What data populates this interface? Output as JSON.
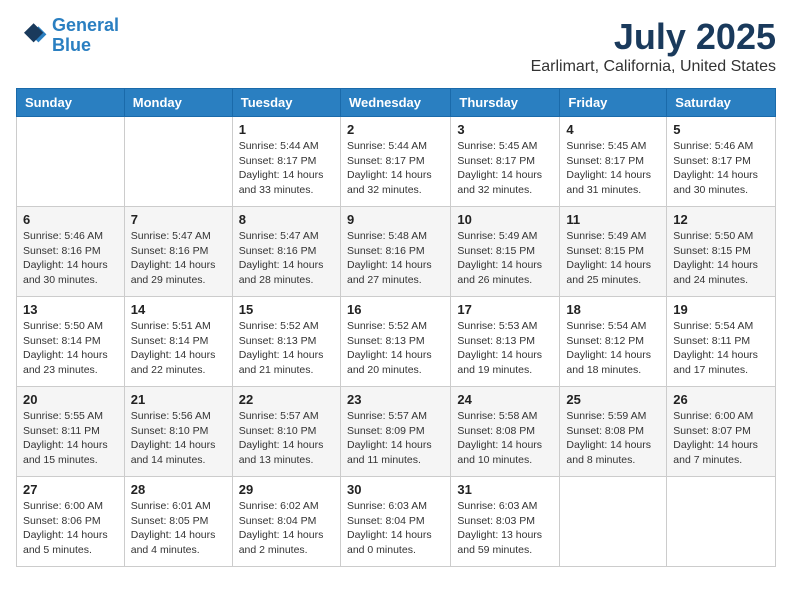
{
  "header": {
    "logo_line1": "General",
    "logo_line2": "Blue",
    "month": "July 2025",
    "location": "Earlimart, California, United States"
  },
  "days_of_week": [
    "Sunday",
    "Monday",
    "Tuesday",
    "Wednesday",
    "Thursday",
    "Friday",
    "Saturday"
  ],
  "weeks": [
    [
      {
        "day": "",
        "info": ""
      },
      {
        "day": "",
        "info": ""
      },
      {
        "day": "1",
        "info": "Sunrise: 5:44 AM\nSunset: 8:17 PM\nDaylight: 14 hours and 33 minutes."
      },
      {
        "day": "2",
        "info": "Sunrise: 5:44 AM\nSunset: 8:17 PM\nDaylight: 14 hours and 32 minutes."
      },
      {
        "day": "3",
        "info": "Sunrise: 5:45 AM\nSunset: 8:17 PM\nDaylight: 14 hours and 32 minutes."
      },
      {
        "day": "4",
        "info": "Sunrise: 5:45 AM\nSunset: 8:17 PM\nDaylight: 14 hours and 31 minutes."
      },
      {
        "day": "5",
        "info": "Sunrise: 5:46 AM\nSunset: 8:17 PM\nDaylight: 14 hours and 30 minutes."
      }
    ],
    [
      {
        "day": "6",
        "info": "Sunrise: 5:46 AM\nSunset: 8:16 PM\nDaylight: 14 hours and 30 minutes."
      },
      {
        "day": "7",
        "info": "Sunrise: 5:47 AM\nSunset: 8:16 PM\nDaylight: 14 hours and 29 minutes."
      },
      {
        "day": "8",
        "info": "Sunrise: 5:47 AM\nSunset: 8:16 PM\nDaylight: 14 hours and 28 minutes."
      },
      {
        "day": "9",
        "info": "Sunrise: 5:48 AM\nSunset: 8:16 PM\nDaylight: 14 hours and 27 minutes."
      },
      {
        "day": "10",
        "info": "Sunrise: 5:49 AM\nSunset: 8:15 PM\nDaylight: 14 hours and 26 minutes."
      },
      {
        "day": "11",
        "info": "Sunrise: 5:49 AM\nSunset: 8:15 PM\nDaylight: 14 hours and 25 minutes."
      },
      {
        "day": "12",
        "info": "Sunrise: 5:50 AM\nSunset: 8:15 PM\nDaylight: 14 hours and 24 minutes."
      }
    ],
    [
      {
        "day": "13",
        "info": "Sunrise: 5:50 AM\nSunset: 8:14 PM\nDaylight: 14 hours and 23 minutes."
      },
      {
        "day": "14",
        "info": "Sunrise: 5:51 AM\nSunset: 8:14 PM\nDaylight: 14 hours and 22 minutes."
      },
      {
        "day": "15",
        "info": "Sunrise: 5:52 AM\nSunset: 8:13 PM\nDaylight: 14 hours and 21 minutes."
      },
      {
        "day": "16",
        "info": "Sunrise: 5:52 AM\nSunset: 8:13 PM\nDaylight: 14 hours and 20 minutes."
      },
      {
        "day": "17",
        "info": "Sunrise: 5:53 AM\nSunset: 8:13 PM\nDaylight: 14 hours and 19 minutes."
      },
      {
        "day": "18",
        "info": "Sunrise: 5:54 AM\nSunset: 8:12 PM\nDaylight: 14 hours and 18 minutes."
      },
      {
        "day": "19",
        "info": "Sunrise: 5:54 AM\nSunset: 8:11 PM\nDaylight: 14 hours and 17 minutes."
      }
    ],
    [
      {
        "day": "20",
        "info": "Sunrise: 5:55 AM\nSunset: 8:11 PM\nDaylight: 14 hours and 15 minutes."
      },
      {
        "day": "21",
        "info": "Sunrise: 5:56 AM\nSunset: 8:10 PM\nDaylight: 14 hours and 14 minutes."
      },
      {
        "day": "22",
        "info": "Sunrise: 5:57 AM\nSunset: 8:10 PM\nDaylight: 14 hours and 13 minutes."
      },
      {
        "day": "23",
        "info": "Sunrise: 5:57 AM\nSunset: 8:09 PM\nDaylight: 14 hours and 11 minutes."
      },
      {
        "day": "24",
        "info": "Sunrise: 5:58 AM\nSunset: 8:08 PM\nDaylight: 14 hours and 10 minutes."
      },
      {
        "day": "25",
        "info": "Sunrise: 5:59 AM\nSunset: 8:08 PM\nDaylight: 14 hours and 8 minutes."
      },
      {
        "day": "26",
        "info": "Sunrise: 6:00 AM\nSunset: 8:07 PM\nDaylight: 14 hours and 7 minutes."
      }
    ],
    [
      {
        "day": "27",
        "info": "Sunrise: 6:00 AM\nSunset: 8:06 PM\nDaylight: 14 hours and 5 minutes."
      },
      {
        "day": "28",
        "info": "Sunrise: 6:01 AM\nSunset: 8:05 PM\nDaylight: 14 hours and 4 minutes."
      },
      {
        "day": "29",
        "info": "Sunrise: 6:02 AM\nSunset: 8:04 PM\nDaylight: 14 hours and 2 minutes."
      },
      {
        "day": "30",
        "info": "Sunrise: 6:03 AM\nSunset: 8:04 PM\nDaylight: 14 hours and 0 minutes."
      },
      {
        "day": "31",
        "info": "Sunrise: 6:03 AM\nSunset: 8:03 PM\nDaylight: 13 hours and 59 minutes."
      },
      {
        "day": "",
        "info": ""
      },
      {
        "day": "",
        "info": ""
      }
    ]
  ]
}
